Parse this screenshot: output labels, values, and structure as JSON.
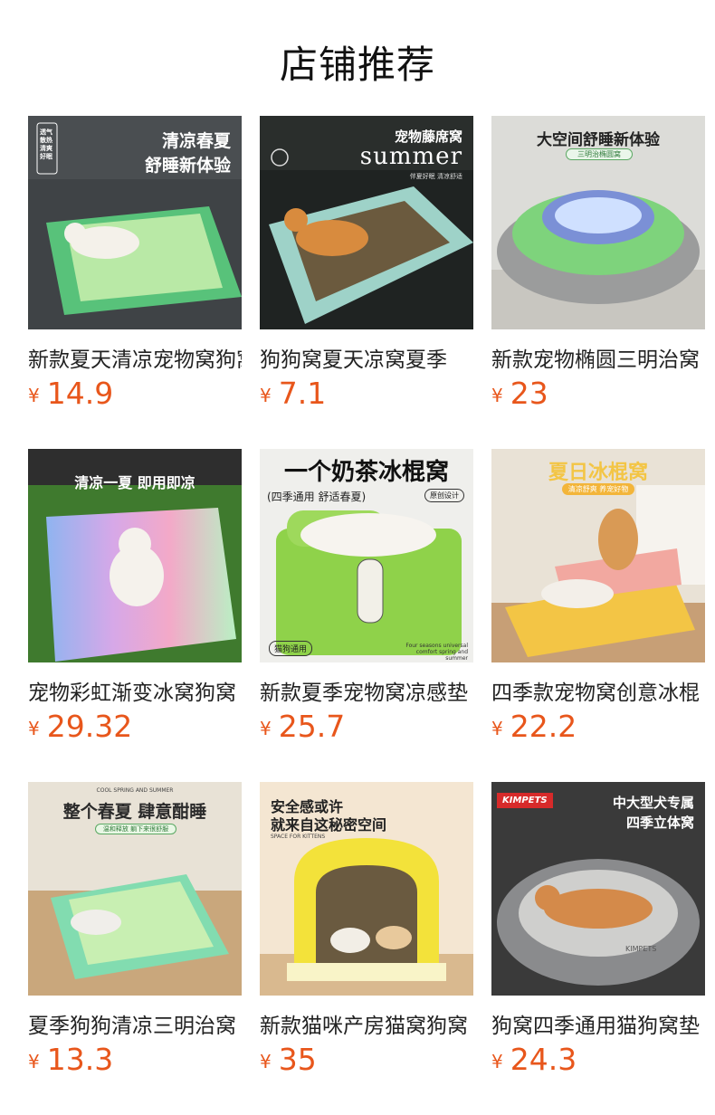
{
  "header": {
    "title": "店铺推荐"
  },
  "currency_symbol": "¥",
  "accent_color": "#e8561b",
  "products": [
    {
      "title": "新款夏天清凉宠物窝狗窝",
      "price": "14.9",
      "overlay": {
        "line1": "清凉春夏",
        "line2": "舒睡新体验",
        "side": "透气散热 清爽好眠"
      }
    },
    {
      "title": "狗狗窝夏天凉窝夏季",
      "price": "7.1",
      "overlay": {
        "line1": "宠物藤席窝",
        "line2": "summer",
        "line3": "伴夏好眠 清凉舒适"
      }
    },
    {
      "title": "新款宠物椭圆三明治窝",
      "price": "23",
      "overlay": {
        "line1": "大空间舒睡新体验",
        "line2": "三明治椭圆窝"
      }
    },
    {
      "title": "宠物彩虹渐变冰窝狗窝",
      "price": "29.32",
      "overlay": {
        "line1": "清凉一夏 即用即凉"
      }
    },
    {
      "title": "新款夏季宠物窝凉感垫",
      "price": "25.7",
      "overlay": {
        "line1": "一个奶茶冰棍窝",
        "line2": "(四季通用 舒适春夏)",
        "badge1": "原创设计",
        "badge2": "猫狗通用",
        "foot": "Four seasons universal comfort spring and summer"
      }
    },
    {
      "title": "四季款宠物窝创意冰棍",
      "price": "22.2",
      "overlay": {
        "line1": "夏日冰棍窝",
        "line2": "清凉舒爽 养宠好物"
      }
    },
    {
      "title": "夏季狗狗清凉三明治窝",
      "price": "13.3",
      "overlay": {
        "top": "COOL SPRING AND SUMMER",
        "line1": "整个春夏 肆意酣睡",
        "line2": "温和释放 躺下来很舒服"
      }
    },
    {
      "title": "新款猫咪产房猫窝狗窝",
      "price": "35",
      "overlay": {
        "line1": "安全感或许",
        "line2": "就来自这秘密空间",
        "line3": "SPACE FOR KITTENS"
      }
    },
    {
      "title": "狗窝四季通用猫狗窝垫",
      "price": "24.3",
      "overlay": {
        "brand": "KIMPETS",
        "line1": "中大型犬专属",
        "line2": "四季立体窝",
        "bed": "KIMPETS"
      }
    }
  ]
}
